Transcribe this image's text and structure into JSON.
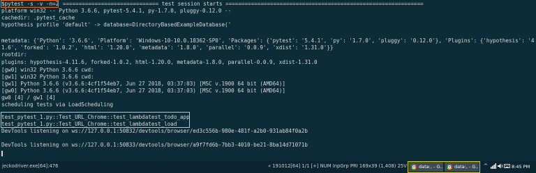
{
  "colors": {
    "background": "#0c2c38",
    "text": "#d8d8d8",
    "highlight_command": "#e8701a",
    "highlight_tests": "#e0d21a",
    "taskbar": "#0a2531"
  },
  "terminal": {
    "prompt": "$",
    "command": "pytest -s -v -n=2",
    "header_line": "============================== test session starts ==============================================================",
    "lines": [
      "platform win32 -- Python 3.6.6, pytest-5.4.1, py-1.7.0, pluggy-0.12.0 --",
      "cachedir: .pytest_cache",
      "hypothesis profile 'default' -> database=DirectoryBasedExampleDatabase('",
      "",
      "metadata: {'Python': '3.6.6', 'Platform': 'Windows-10-10.0.18362-SP0', 'Packages': {'pytest': '5.4.1', 'py': '1.7.0', 'pluggy': '0.12.0'}, 'Plugins': {'hypothesis': '4.1",
      "1.6', 'forked': '1.0.2', 'html': '1.20.0', 'metadata': '1.8.0', 'parallel': '0.0.9', 'xdist': '1.31.0'}}",
      "rootdir:",
      "plugins: hypothesis-4.11.6, forked-1.0.2, html-1.20.0, metadata-1.8.0, parallel-0.0.9, xdist-1.31.0",
      "[gw0] win32 Python 3.6.6 cwd:",
      "[gw1] win32 Python 3.6.6 cwd:",
      "[gw1] Python 3.6.6 (v3.6.6:4cf1f54eb7, Jun 27 2018, 03:37:03) [MSC v.1900 64 bit (AMD64)]",
      "[gw0] Python 3.6.6 (v3.6.6:4cf1f54eb7, Jun 27 2018, 03:37:03) [MSC v.1900 64 bit (AMD64)]",
      "gw0 [4] / gw1 [4]",
      "scheduling tests via LoadScheduling",
      "",
      "test_pytest_1.py::Test_URL_Chrome::test_lambdatest_todo_app",
      "test_pytest_1.py::Test_URL_Chrome::test_lambdatest_load",
      "DevTools listening on ws://127.0.0.1:50832/devtools/browser/ed3c556b-980e-481f-a2b0-931ab84f0a2b",
      "",
      "DevTools listening on ws://127.0.0.1:50833/devtools/browser/a9f7fd6b-7bb3-4010-be21-8ba14d71071b"
    ]
  },
  "statusbar": {
    "process": "jeckodriver.exe[64]:476",
    "info": "« 191012[64]   1/1   [+] NUM  InpGrp   PRI   169x39   (1,408) 25V   2016  100%"
  },
  "taskbar": {
    "items": [
      {
        "label": "data:, - G..."
      },
      {
        "label": "data:, - G..."
      }
    ],
    "tray_icons": [
      "chevron-up-icon",
      "network-icon",
      "volume-icon",
      "keyboard-icon"
    ],
    "time": "8:45 PM"
  }
}
